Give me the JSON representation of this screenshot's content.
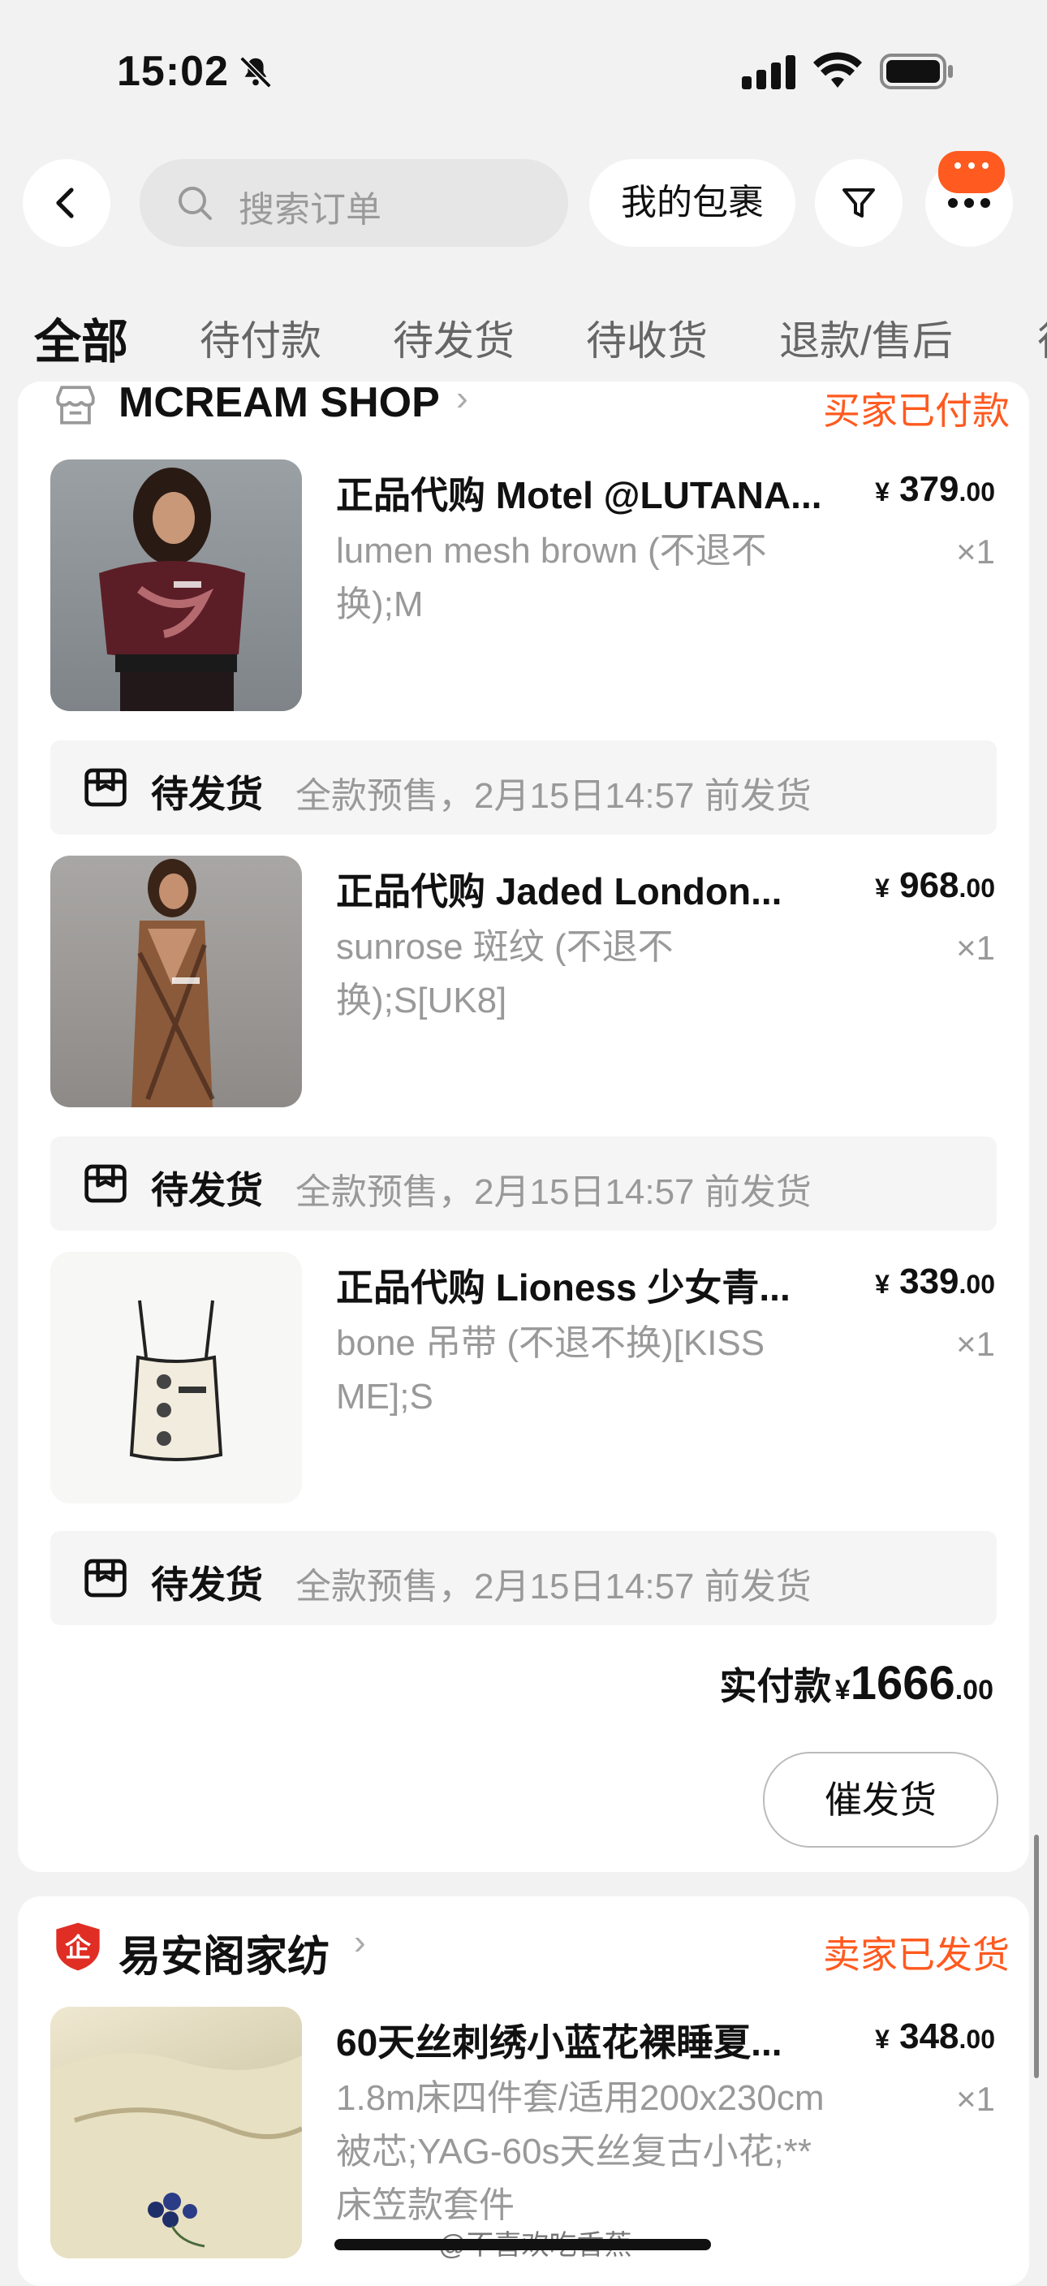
{
  "status_bar": {
    "time": "15:02"
  },
  "header": {
    "search_placeholder": "搜索订单",
    "packages_label": "我的包裹",
    "accent": "#ff5a1f"
  },
  "tabs": [
    "全部",
    "待付款",
    "待发货",
    "待收货",
    "退款/售后",
    "待"
  ],
  "order1": {
    "shop_name": "MCREAM SHOP",
    "status": "买家已付款",
    "items": [
      {
        "title": "正品代购 Motel @LUTANA...",
        "spec": "lumen mesh brown (不退不换);M",
        "price_int": "379",
        "price_dec": ".00",
        "qty": "×1",
        "ship_label": "待发货",
        "ship_text": "全款预售，2月15日14:57 前发货"
      },
      {
        "title": "正品代购 Jaded London...",
        "spec": "sunrose 斑纹 (不退不换);S[UK8]",
        "price_int": "968",
        "price_dec": ".00",
        "qty": "×1",
        "ship_label": "待发货",
        "ship_text": "全款预售，2月15日14:57 前发货"
      },
      {
        "title": "正品代购 Lioness 少女青...",
        "spec": "bone 吊带 (不退不换)[KISS ME];S",
        "price_int": "339",
        "price_dec": ".00",
        "qty": "×1",
        "ship_label": "待发货",
        "ship_text": "全款预售，2月15日14:57 前发货"
      }
    ],
    "total_label": "实付款",
    "currency": "¥",
    "total_int": "1666",
    "total_dec": ".00",
    "urge_button": "催发货"
  },
  "order2": {
    "shop_name": "易安阁家纺",
    "status": "卖家已发货",
    "items": [
      {
        "title": "60天丝刺绣小蓝花裸睡夏...",
        "spec": "1.8m床四件套/适用200x230cm被芯;YAG-60s天丝复古小花;**床笠款套件",
        "price_int": "348",
        "price_dec": ".00",
        "qty": "×1"
      }
    ]
  },
  "watermark": "@不喜欢吃香蕉-"
}
